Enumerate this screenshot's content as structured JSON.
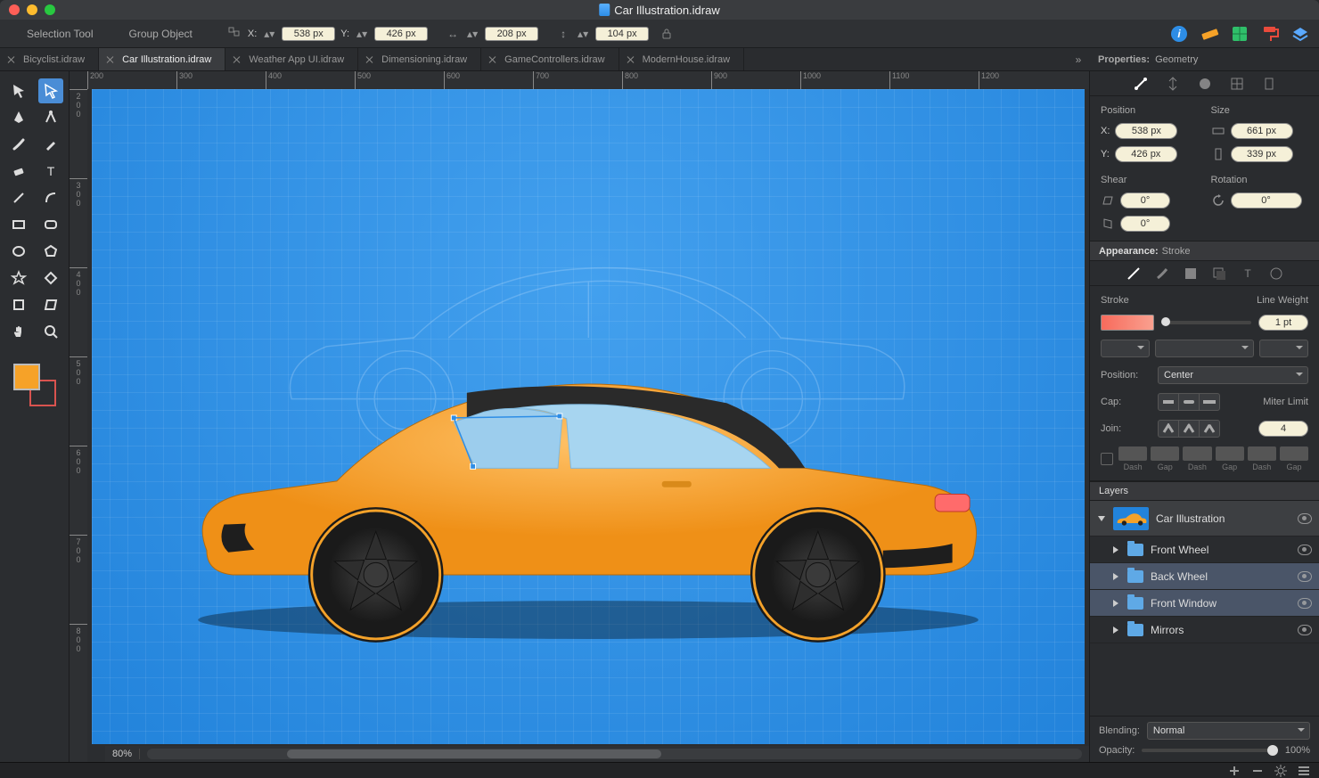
{
  "window_title": "Car Illustration.idraw",
  "context": {
    "tool_name": "Selection Tool",
    "object_name": "Group Object",
    "x_label": "X:",
    "x_value": "538 px",
    "y_label": "Y:",
    "y_value": "426 px",
    "w_value": "208 px",
    "h_value": "104 px"
  },
  "tabs": [
    {
      "label": "Bicyclist.idraw",
      "active": false
    },
    {
      "label": "Car Illustration.idraw",
      "active": true
    },
    {
      "label": "Weather App UI.idraw",
      "active": false
    },
    {
      "label": "Dimensioning.idraw",
      "active": false
    },
    {
      "label": "GameControllers.idraw",
      "active": false
    },
    {
      "label": "ModernHouse.idraw",
      "active": false
    }
  ],
  "ruler_h": [
    "200",
    "300",
    "400",
    "500",
    "600",
    "700",
    "800",
    "900",
    "1000",
    "1100",
    "1200"
  ],
  "ruler_v": [
    "2",
    "3",
    "4",
    "5",
    "6",
    "7",
    "8"
  ],
  "zoom": "80%",
  "properties": {
    "panel_title_key": "Properties:",
    "panel_title_val": "Geometry",
    "position_label": "Position",
    "size_label": "Size",
    "x_label": "X:",
    "x_val": "538 px",
    "y_label": "Y:",
    "y_val": "426 px",
    "w_val": "661 px",
    "h_val": "339 px",
    "shear_label": "Shear",
    "rotation_label": "Rotation",
    "shear_h": "0°",
    "shear_v": "0°",
    "rotation": "0°"
  },
  "appearance": {
    "title_key": "Appearance:",
    "title_val": "Stroke",
    "stroke_label": "Stroke",
    "lineweight_label": "Line Weight",
    "lineweight_val": "1 pt",
    "position_label": "Position:",
    "position_val": "Center",
    "cap_label": "Cap:",
    "join_label": "Join:",
    "miter_label": "Miter Limit",
    "miter_val": "4",
    "dash_labels": [
      "Dash",
      "Gap",
      "Dash",
      "Gap",
      "Dash",
      "Gap"
    ]
  },
  "layers": {
    "title": "Layers",
    "master": "Car Illustration",
    "items": [
      {
        "name": "Front Wheel",
        "selected": false
      },
      {
        "name": "Back Wheel",
        "selected": true
      },
      {
        "name": "Front Window",
        "selected": true
      },
      {
        "name": "Mirrors",
        "selected": false
      }
    ],
    "blending_label": "Blending:",
    "blending_val": "Normal",
    "opacity_label": "Opacity:",
    "opacity_val": "100%"
  },
  "colors": {
    "close": "#ff5f57",
    "min": "#febc2e",
    "max": "#28c840",
    "info": "#2d8de6",
    "ruler": "#f6a228",
    "brand_green": "#2fbf6a",
    "brand_red": "#e94b3c",
    "brand_blue": "#5aa9ff"
  }
}
